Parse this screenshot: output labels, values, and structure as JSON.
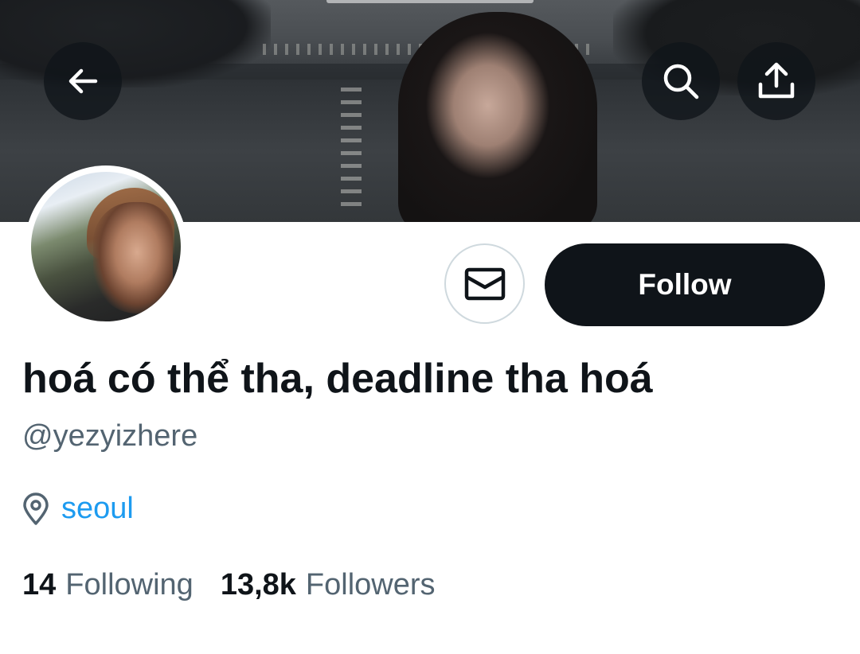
{
  "header": {
    "back_icon": "arrow-left-icon",
    "search_icon": "search-icon",
    "share_icon": "share-upload-icon"
  },
  "profile": {
    "display_name": "hoá có thể tha, deadline tha hoá",
    "handle": "@yezyizhere",
    "location": "seoul",
    "location_icon": "location-pin-icon",
    "following_count": "14",
    "following_label": "Following",
    "followers_count": "13,8k",
    "followers_label": "Followers"
  },
  "actions": {
    "message_icon": "envelope-icon",
    "follow_label": "Follow"
  },
  "colors": {
    "primary_text": "#0f1419",
    "secondary_text": "#536471",
    "link": "#1d9bf0",
    "follow_button_bg": "#0f1419",
    "follow_button_text": "#ffffff"
  }
}
